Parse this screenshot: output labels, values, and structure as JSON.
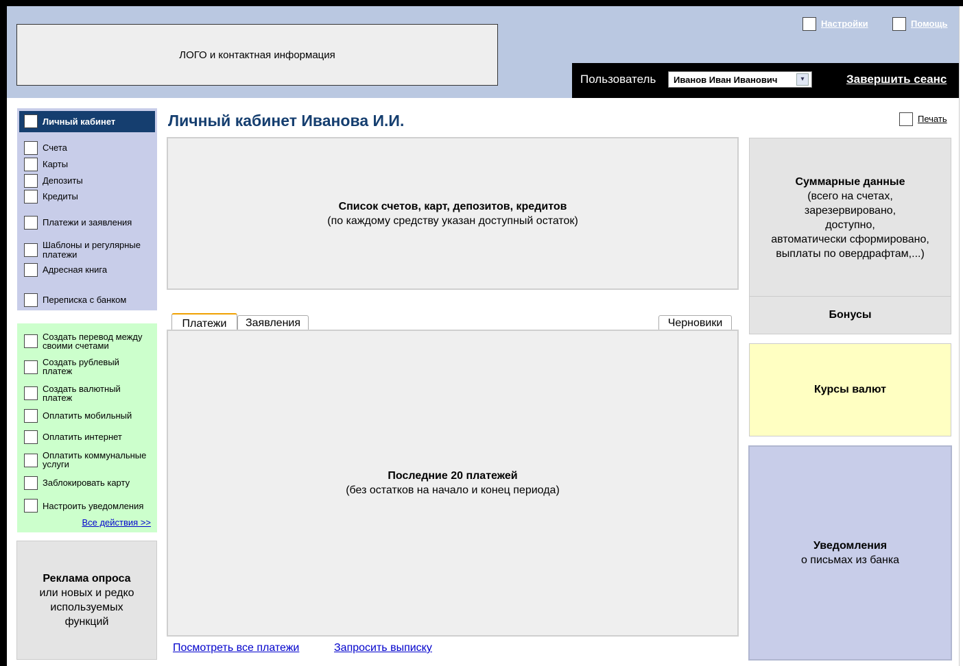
{
  "header": {
    "logo_text": "ЛОГО и контактная информация",
    "settings_link": "Настройки",
    "help_link": "Помощь",
    "user_label": "Пользователь",
    "user_value": "Иванов Иван Иванович",
    "logout_link": "Завершить сеанс"
  },
  "sidebar": {
    "active_item": "Личный кабинет",
    "nav_items": [
      "Счета",
      "Карты",
      "Депозиты",
      "Кредиты",
      "Платежи и заявления",
      "Шаблоны и регулярные платежи",
      "Адресная книга",
      "Переписка с банком"
    ],
    "actions": [
      "Создать перевод между своими счетами",
      "Создать рублевый платеж",
      "Создать валютный платеж",
      "Оплатить мобильный",
      "Оплатить интернет",
      "Оплатить коммунальные услуги",
      "Заблокировать карту",
      "Настроить уведомления"
    ],
    "all_actions_link": "Все действия >>",
    "ad_title": "Реклама опроса",
    "ad_text": "или новых и редко используемых функций"
  },
  "main": {
    "title": "Личный кабинет Иванова И.И.",
    "print_link": "Печать",
    "accounts_title": "Список счетов, карт, депозитов, кредитов",
    "accounts_subtitle": "(по каждому средству указан доступный остаток)",
    "tabs": [
      "Платежи",
      "Заявления"
    ],
    "drafts_tab": "Черновики",
    "payments_title": "Последние 20 платежей",
    "payments_subtitle": "(без остатков на начало и конец периода)",
    "view_all_link": "Посмотреть все платежи",
    "request_statement_link": "Запросить выписку"
  },
  "right": {
    "summary_title": "Суммарные данные",
    "summary_lines": [
      "(всего на счетах,",
      "зарезервировано,",
      "доступно,",
      "автоматически сформировано,",
      "выплаты по овердрафтам,...)"
    ],
    "bonus_title": "Бонусы",
    "rates_title": "Курсы валют",
    "notify_title": "Уведомления",
    "notify_subtitle": "о письмах из банка"
  },
  "colors": {
    "header_bg": "#bac8e1",
    "nav_bg": "#c8cde9",
    "nav_active_bg": "#153e6f",
    "actions_bg": "#ccffcc",
    "rates_bg": "#ffffc2",
    "title_color": "#153e6f"
  }
}
